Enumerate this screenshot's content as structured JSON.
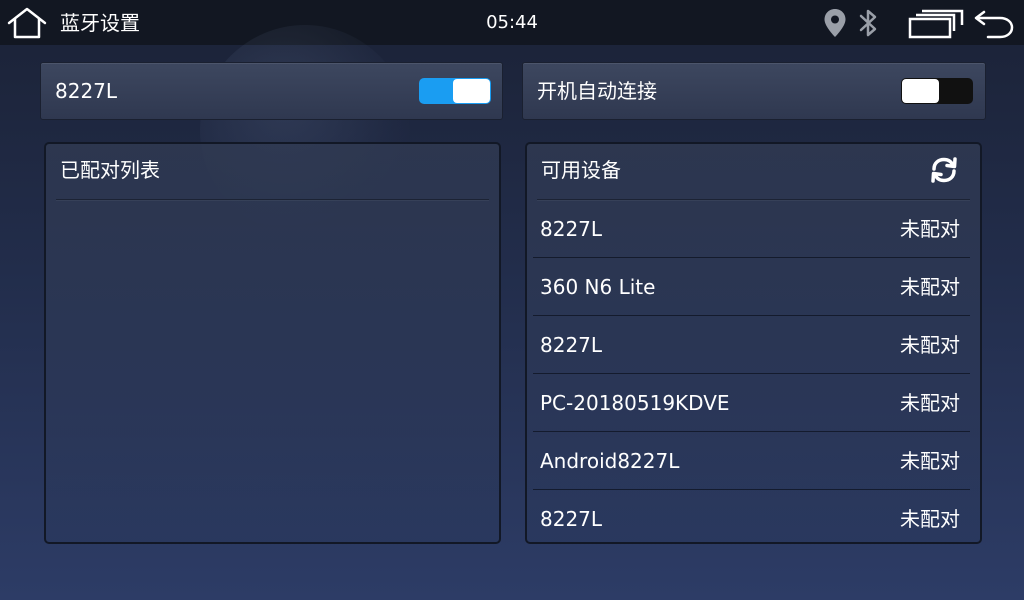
{
  "status_bar": {
    "title": "蓝牙设置",
    "time": "05:44",
    "icons": [
      "home-icon",
      "location-icon",
      "bluetooth-icon",
      "recent-apps-icon",
      "back-icon"
    ]
  },
  "device_card": {
    "name": "8227L",
    "bluetooth_on": true
  },
  "autoconnect_card": {
    "label": "开机自动连接",
    "enabled": false
  },
  "paired_panel": {
    "title": "已配对列表",
    "items": []
  },
  "available_panel": {
    "title": "可用设备",
    "refresh_icon": "refresh-icon",
    "devices": [
      {
        "name": "8227L",
        "status": "未配对"
      },
      {
        "name": "360 N6 Lite",
        "status": "未配对"
      },
      {
        "name": "8227L",
        "status": "未配对"
      },
      {
        "name": "PC-20180519KDVE",
        "status": "未配对"
      },
      {
        "name": "Android8227L",
        "status": "未配对"
      },
      {
        "name": "8227L",
        "status": "未配对"
      }
    ]
  },
  "colors": {
    "toggle_on": "#1a9df2",
    "toggle_off": "#111111",
    "status_bar_bg": "#121722"
  }
}
